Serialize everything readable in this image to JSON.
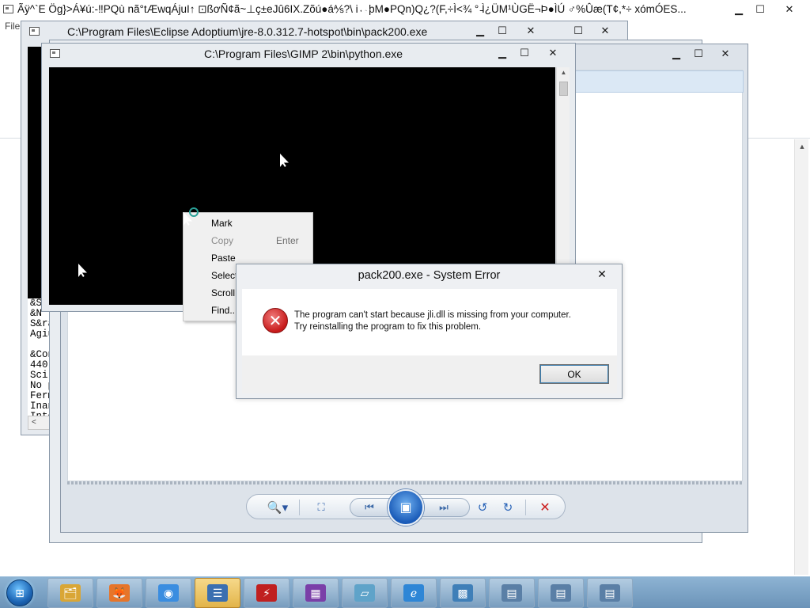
{
  "background_window": {
    "title": "Ãÿ^`E Ög}>Á¥ú:-‼PQù nã°tÆwqÁjuI↑ ⊡ßơÑ¢ã~⊥ç±eJû6IX.Zõú●á⅍?\\ i↔þM●PQn)Q¿?(F,÷Ì<¾ ° ̵Ì¿ÜM¹ÙGË¬Þ●ÌÚ ♂%Ûæ(T¢,*÷ xómÓES...",
    "menu_label": "File"
  },
  "eclipse_window": {
    "title": "C:\\Program Files\\Eclipse Adoptium\\jre-8.0.312.7-hotspot\\bin\\pack200.exe",
    "console_lines": [
      "&S",
      "&N",
      "S&ra",
      "Agiut",
      "",
      "&Cont",
      "440",
      "Sci p",
      "No pe",
      "Ferma",
      "Inand",
      "Into"
    ]
  },
  "python_window": {
    "title": "C:\\Program Files\\GIMP 2\\bin\\python.exe"
  },
  "context_menu": {
    "items": [
      {
        "label": "Mark",
        "accel": "",
        "enabled": true
      },
      {
        "label": "Copy",
        "accel": "Enter",
        "enabled": false
      },
      {
        "label": "Paste",
        "accel": "",
        "enabled": true
      },
      {
        "label": "Select All",
        "accel": "",
        "enabled": true
      },
      {
        "label": "Scroll",
        "accel": "",
        "enabled": true
      },
      {
        "label": "Find...",
        "accel": "",
        "enabled": true
      }
    ]
  },
  "error_dialog": {
    "title": "pack200.exe - System Error",
    "message_line1": "The program can't start because jli.dll is missing from your computer.",
    "message_line2": "Try reinstalling the program to fix this problem.",
    "ok_label": "OK",
    "icon": "error-icon",
    "icon_color": "#c71a1a"
  },
  "window_controls": {
    "minimize": "▁",
    "maximize": "☐",
    "close": "✕"
  },
  "photo_viewer": {
    "toolbar_icons": {
      "zoom": "🔍▾",
      "fit": "⛶",
      "prev": "⏮",
      "slideshow": "▣",
      "next": "⏭",
      "rotate_left": "↺",
      "rotate_right": "↻",
      "delete": "✕"
    }
  },
  "taskbar": {
    "start_icon": "windows-logo-icon",
    "items": [
      {
        "name": "file-explorer",
        "glyph": "🗂",
        "active": false
      },
      {
        "name": "firefox",
        "glyph": "🦊",
        "active": false
      },
      {
        "name": "chrome",
        "glyph": "◉",
        "active": false
      },
      {
        "name": "list-app",
        "glyph": "☰",
        "active": true
      },
      {
        "name": "flash-app",
        "glyph": "⚡",
        "active": false
      },
      {
        "name": "winrar",
        "glyph": "▦",
        "active": false
      },
      {
        "name": "notepad-app",
        "glyph": "▱",
        "active": false
      },
      {
        "name": "internet-explorer",
        "glyph": "ℯ",
        "active": false
      },
      {
        "name": "photo-viewer",
        "glyph": "▩",
        "active": false
      },
      {
        "name": "window-1",
        "glyph": "▤",
        "active": false
      },
      {
        "name": "window-2",
        "glyph": "▤",
        "active": false
      },
      {
        "name": "window-3",
        "glyph": "▤",
        "active": false
      }
    ]
  }
}
